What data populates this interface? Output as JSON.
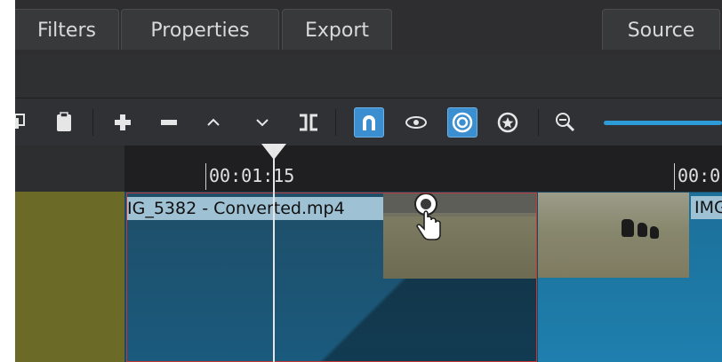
{
  "tabs": [
    {
      "label": "Filters"
    },
    {
      "label": "Properties"
    },
    {
      "label": "Export"
    },
    {
      "label": "Source"
    }
  ],
  "toolbar": {
    "buttons": [
      "copy-icon",
      "paste-icon",
      "append-icon",
      "remove-icon",
      "lift-icon",
      "overwrite-icon",
      "split-icon",
      "snap-icon",
      "scrub-icon",
      "ripple-icon",
      "ripple-all-icon",
      "zoom-out-icon"
    ]
  },
  "ruler": {
    "marks": [
      {
        "label": "00:01:15"
      },
      {
        "label": "00:0"
      }
    ]
  },
  "timeline": {
    "clip1_name": "IG_5382 - Converted.mp4",
    "clip2_name": "IMG"
  },
  "colors": {
    "accent": "#3b8fd0",
    "track_header": "#6b6a27",
    "clip_selected_border": "#c53838"
  }
}
